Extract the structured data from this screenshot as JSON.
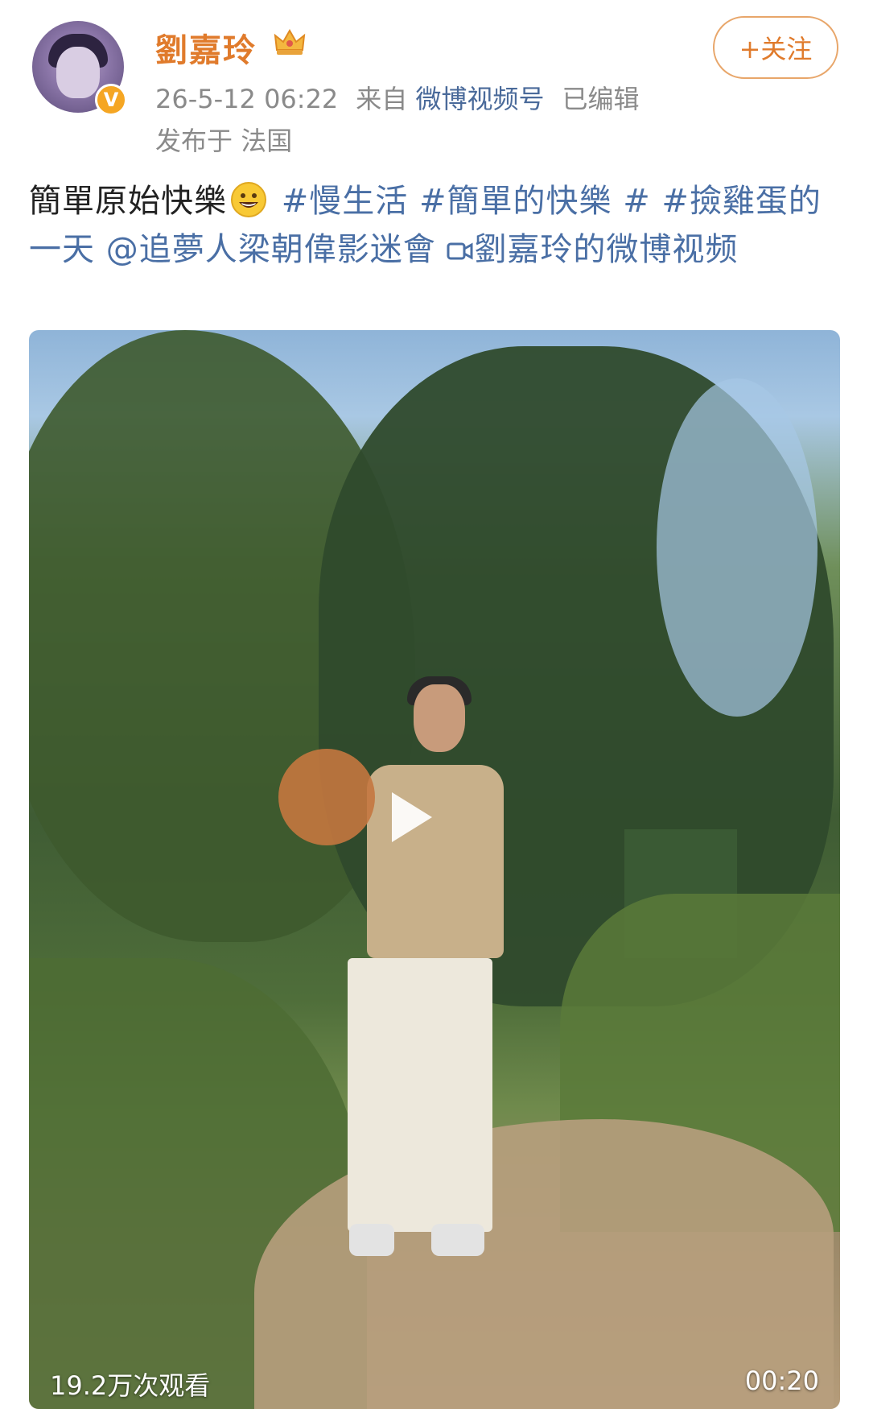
{
  "author": {
    "name": "劉嘉玲",
    "verified_badge": "V",
    "crown_icon": "crown-icon"
  },
  "meta": {
    "timestamp": "26-5-12 06:22",
    "from_label": "来自",
    "source": "微博视频号",
    "edited": "已编辑",
    "location_label": "发布于",
    "location": "法国"
  },
  "follow_button": {
    "label": "+关注"
  },
  "post": {
    "text_main": "簡單原始快樂",
    "emoji": "grinning-face",
    "tag1": "#慢生活",
    "tag2": "#簡單的快樂",
    "tag3": "#",
    "tag4": "#撿雞蛋的一天",
    "mention": "@追夢人梁朝偉影迷會",
    "video_link": "劉嘉玲的微博视频"
  },
  "video": {
    "views": "19.2万次观看",
    "duration": "00:20",
    "play_icon": "play-icon"
  },
  "colors": {
    "username": "#e07b2c",
    "link": "#4a6fa5",
    "meta": "#8a8a8a",
    "follow_border": "#e8a66a",
    "badge": "#f5a623"
  }
}
